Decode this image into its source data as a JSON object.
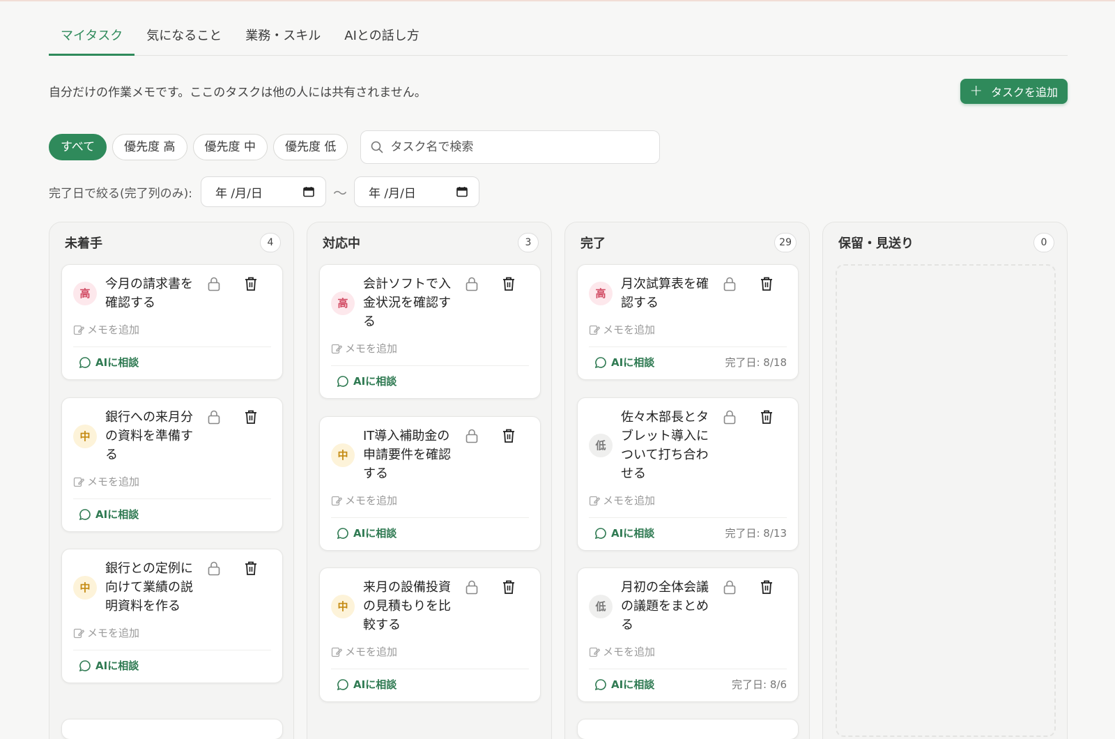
{
  "tabs": [
    "マイタスク",
    "気になること",
    "業務・スキル",
    "AIとの話し方"
  ],
  "description": "自分だけの作業メモです。ここのタスクは他の人には共有されません。",
  "add_button": "タスクを追加",
  "filters": [
    "すべて",
    "優先度 高",
    "優先度 中",
    "優先度 低"
  ],
  "search_placeholder": "タスク名で検索",
  "date_filter": {
    "label": "完了日で絞る(完了列のみ):",
    "from": "年 /月/日",
    "to": "年 /月/日",
    "sep": "〜"
  },
  "card_labels": {
    "memo": "メモを追加",
    "ai": "AIに相談"
  },
  "columns": [
    {
      "title": "未着手",
      "count": "4",
      "cards": [
        {
          "priority": "高",
          "title": "今月の請求書を確認する",
          "done": ""
        },
        {
          "priority": "中",
          "title": "銀行への来月分の資料を準備する",
          "done": ""
        },
        {
          "priority": "中",
          "title": "銀行との定例に向けて業績の説明資料を作る",
          "done": ""
        }
      ]
    },
    {
      "title": "対応中",
      "count": "3",
      "cards": [
        {
          "priority": "高",
          "title": "会計ソフトで入金状況を確認する",
          "done": ""
        },
        {
          "priority": "中",
          "title": "IT導入補助金の申請要件を確認する",
          "done": ""
        },
        {
          "priority": "中",
          "title": "来月の設備投資の見積もりを比較する",
          "done": ""
        }
      ]
    },
    {
      "title": "完了",
      "count": "29",
      "cards": [
        {
          "priority": "高",
          "title": "月次試算表を確認する",
          "done": "完了日: 8/18"
        },
        {
          "priority": "低",
          "title": "佐々木部長とタブレット導入について打ち合わせる",
          "done": "完了日: 8/13"
        },
        {
          "priority": "低",
          "title": "月初の全体会議の議題をまとめる",
          "done": "完了日: 8/6"
        }
      ]
    },
    {
      "title": "保留・見送り",
      "count": "0",
      "cards": []
    }
  ],
  "colors": {
    "accent": "#2f8a5b",
    "high": "#d14a62",
    "mid": "#c48a12",
    "low": "#777777"
  }
}
